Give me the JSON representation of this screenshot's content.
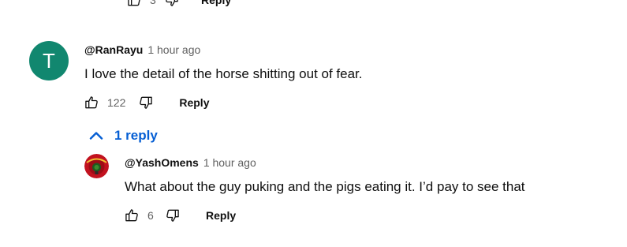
{
  "top_actions": {
    "like_count": "3",
    "reply_label": "Reply"
  },
  "comment": {
    "avatar_letter": "T",
    "avatar_color": "#11876f",
    "author": "@RanRayu",
    "time": "1 hour ago",
    "text": "I love the detail of the horse shitting out of fear.",
    "like_count": "122",
    "reply_label": "Reply",
    "replies_toggle": "1 reply"
  },
  "reply": {
    "author": "@YashOmens",
    "time": "1 hour ago",
    "text": "What about the guy puking and the pigs eating it. I’d pay to see that",
    "like_count": "6",
    "reply_label": "Reply"
  },
  "icons": {
    "like": "thumb-up-icon",
    "dislike": "thumb-down-icon",
    "toggle": "chevron-up-icon"
  },
  "colors": {
    "link": "#065fd4",
    "secondary_text": "#606060"
  }
}
